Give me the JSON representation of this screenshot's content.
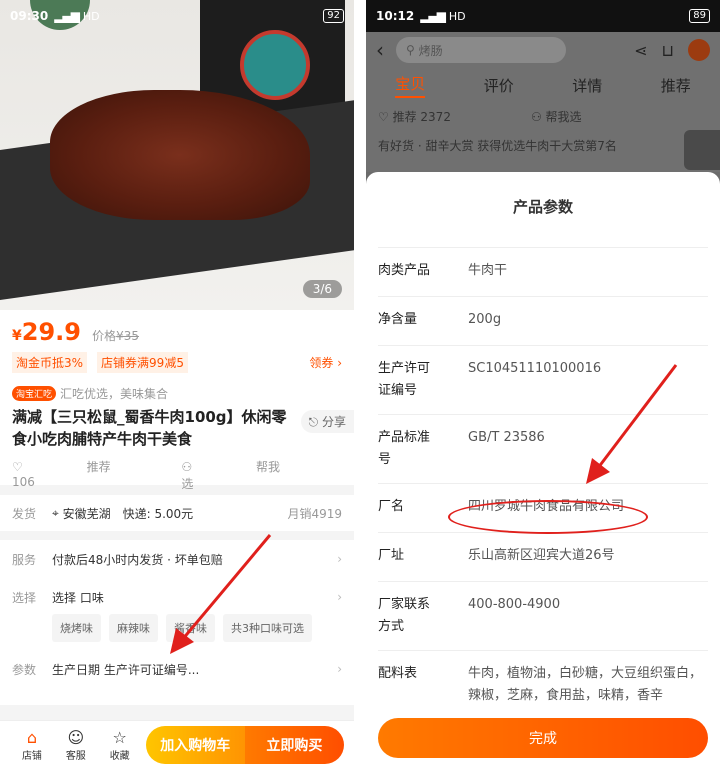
{
  "left": {
    "status": {
      "time": "09:30",
      "net": "HD",
      "battery": "92"
    },
    "gallery_counter": "3/6",
    "price": {
      "symbol": "¥",
      "value": "29.9",
      "origin_label": "价格",
      "origin_value": "¥35"
    },
    "promos": [
      "淘金币抵3%",
      "店铺券满99减5"
    ],
    "claim_label": "领券",
    "shop_tag": "淘宝汇吃",
    "shop_slogan": "汇吃优选，美味集合",
    "title": "满减【三只松鼠_蜀香牛肉100g】休闲零食小吃肉脯特产牛肉干美食",
    "share_label": "分享",
    "recommend_label": "推荐 106",
    "help_pick_label": "帮我选",
    "delivery": {
      "label": "发货",
      "location": "安徽芜湖",
      "express": "快递: 5.00元",
      "sales": "月销4919"
    },
    "service": {
      "label": "服务",
      "text": "付款后48小时内发货 · 坏单包赔"
    },
    "choose": {
      "label": "选择",
      "text": "选择 口味"
    },
    "flavors": [
      "烧烤味",
      "麻辣味",
      "酱香味",
      "共3种口味可选"
    ],
    "params": {
      "label": "参数",
      "text": "生产日期 生产许可证编号..."
    },
    "bottom": {
      "shop": "店铺",
      "service": "客服",
      "fav": "收藏",
      "cart": "加入购物车",
      "buy": "立即购买"
    }
  },
  "right": {
    "status": {
      "time": "10:12",
      "net": "HD",
      "battery": "89"
    },
    "search_placeholder": "烤肠",
    "tabs": [
      "宝贝",
      "评价",
      "详情",
      "推荐"
    ],
    "recommend_label": "推荐 2372",
    "help_pick_label": "帮我选",
    "rank_text": "有好货 · 甜辛大赏 获得优选牛肉干大赏第7名",
    "sheet_title": "产品参数",
    "params": [
      {
        "key": "肉类产品",
        "value": "牛肉干"
      },
      {
        "key": "净含量",
        "value": "200g"
      },
      {
        "key": "生产许可证编号",
        "value": "SC10451110100016"
      },
      {
        "key": "产品标准号",
        "value": "GB/T 23586"
      },
      {
        "key": "厂名",
        "value": "四川罗城牛肉食品有限公司"
      },
      {
        "key": "厂址",
        "value": "乐山高新区迎宾大道26号"
      },
      {
        "key": "厂家联系方式",
        "value": "400-800-4900"
      },
      {
        "key": "配料表",
        "value": "牛肉，植物油，白砂糖，大豆组织蛋白，辣椒，芝麻，食用盐，味精，香辛"
      }
    ],
    "done_label": "完成"
  },
  "colors": {
    "accent": "#ff5000",
    "annotation": "#e0201c"
  },
  "icons": [
    "search-icon",
    "share-icon",
    "cart-icon",
    "heart-icon",
    "store-icon",
    "chat-icon",
    "star-icon",
    "chevron-right-icon",
    "back-icon",
    "pin-icon"
  ]
}
